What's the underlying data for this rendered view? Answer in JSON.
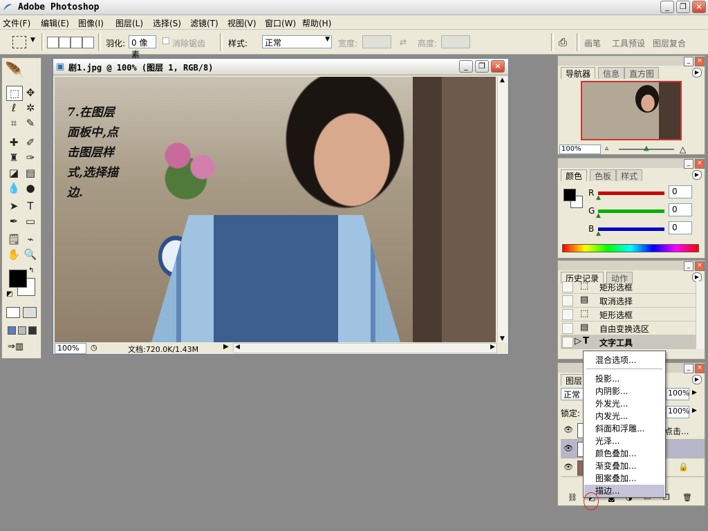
{
  "app": {
    "title": "Adobe Photoshop",
    "window_buttons": [
      "_",
      "❐",
      "×"
    ]
  },
  "menu": [
    "文件(F)",
    "编辑(E)",
    "图像(I)",
    "图层(L)",
    "选择(S)",
    "滤镜(T)",
    "视图(V)",
    "窗口(W)",
    "帮助(H)"
  ],
  "options": {
    "feather_label": "羽化:",
    "feather_value": "0 像素",
    "antialias_label": "消除锯齿",
    "style_label": "样式:",
    "style_value": "正常",
    "width_label": "宽度:",
    "height_label": "高度:",
    "palette_well": [
      "画笔",
      "工具预设",
      "图层复合"
    ]
  },
  "document": {
    "title": "剧1.jpg @ 100% (图层 1, RGB/8)",
    "zoom": "100%",
    "doc_size": "文档:720.0K/1.43M",
    "canvas_note": [
      "7.在图层",
      "面板中,点",
      "击图层样",
      "式,选择描",
      "边."
    ]
  },
  "navigator": {
    "tabs": [
      "导航器",
      "信息",
      "直方图"
    ],
    "zoom": "100%"
  },
  "color": {
    "tabs": [
      "颜色",
      "色板",
      "样式"
    ],
    "channels": [
      {
        "label": "R",
        "value": "0",
        "color": "#cc0000"
      },
      {
        "label": "G",
        "value": "0",
        "color": "#00b000"
      },
      {
        "label": "B",
        "value": "0",
        "color": "#0000cc"
      }
    ]
  },
  "history": {
    "tabs": [
      "历史记录",
      "动作"
    ],
    "items": [
      {
        "label": "矩形选框",
        "icon": "marquee-icon"
      },
      {
        "label": "取消选择",
        "icon": "document-icon"
      },
      {
        "label": "矩形选框",
        "icon": "marquee-icon"
      },
      {
        "label": "自由变换选区",
        "icon": "document-icon"
      },
      {
        "label": "文字工具",
        "icon": "type-icon"
      }
    ]
  },
  "layers": {
    "tab": "图层",
    "blend_mode": "正常",
    "opacity": "100%",
    "lock_label": "锁定:",
    "fill": "100%",
    "partial_layer_text": "点击..."
  },
  "context_menu": {
    "items": [
      "混合选项...",
      "投影...",
      "内阴影...",
      "外发光...",
      "内发光...",
      "斜面和浮雕...",
      "光泽...",
      "颜色叠加...",
      "渐变叠加...",
      "图案叠加...",
      "描边..."
    ],
    "highlighted": "描边..."
  },
  "colors": {
    "highlight_circle": "#e0201c",
    "foreground": "#000000",
    "background": "#ffffff"
  }
}
